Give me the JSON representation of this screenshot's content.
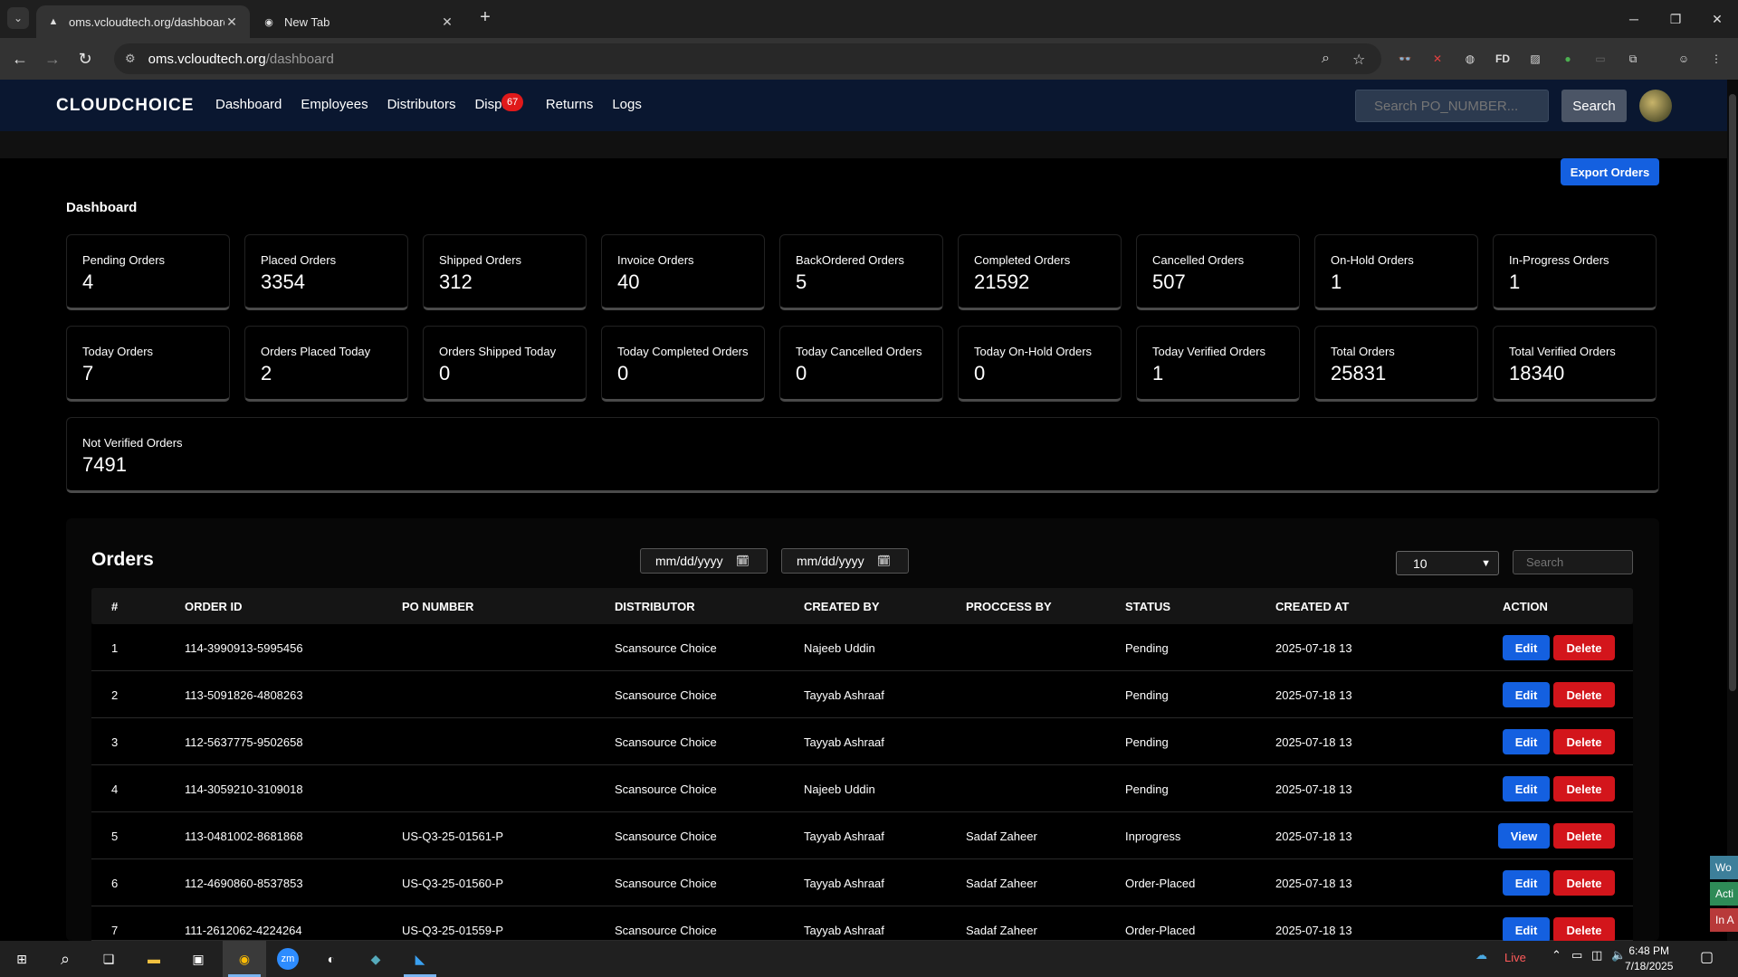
{
  "browser": {
    "tabs": [
      {
        "title": "oms.vcloudtech.org/dashboard",
        "favicon": "triangle-icon"
      },
      {
        "title": "New Tab",
        "favicon": "chrome-icon"
      }
    ],
    "url_host": "oms.vcloudtech.org",
    "url_path": "/dashboard"
  },
  "app": {
    "logo": "CLOUDCHOICE",
    "nav": [
      "Dashboard",
      "Employees",
      "Distributors",
      "Dispu",
      "Returns",
      "Logs"
    ],
    "disputes_badge": "67",
    "search_placeholder": "Search PO_NUMBER...",
    "search_button": "Search",
    "export_button": "Export Orders",
    "section_title": "Dashboard"
  },
  "stats": [
    {
      "label": "Pending Orders",
      "value": "4"
    },
    {
      "label": "Placed Orders",
      "value": "3354"
    },
    {
      "label": "Shipped Orders",
      "value": "312"
    },
    {
      "label": "Invoice Orders",
      "value": "40"
    },
    {
      "label": "BackOrdered Orders",
      "value": "5"
    },
    {
      "label": "Completed Orders",
      "value": "21592"
    },
    {
      "label": "Cancelled Orders",
      "value": "507"
    },
    {
      "label": "On-Hold Orders",
      "value": "1"
    },
    {
      "label": "In-Progress Orders",
      "value": "1"
    },
    {
      "label": "Today Orders",
      "value": "7"
    },
    {
      "label": "Orders Placed Today",
      "value": "2"
    },
    {
      "label": "Orders Shipped Today",
      "value": "0"
    },
    {
      "label": "Today Completed Orders",
      "value": "0"
    },
    {
      "label": "Today Cancelled Orders",
      "value": "0"
    },
    {
      "label": "Today On-Hold Orders",
      "value": "0"
    },
    {
      "label": "Today Verified Orders",
      "value": "1"
    },
    {
      "label": "Total Orders",
      "value": "25831"
    },
    {
      "label": "Total Verified Orders",
      "value": "18340"
    },
    {
      "label": "Not Verified Orders",
      "value": "7491"
    }
  ],
  "orders": {
    "title": "Orders",
    "date_from_placeholder": "mm/dd/yyyy",
    "date_to_placeholder": "mm/dd/yyyy",
    "page_size": "10",
    "search_placeholder": "Search",
    "columns": [
      "#",
      "ORDER ID",
      "PO NUMBER",
      "DISTRIBUTOR",
      "CREATED BY",
      "PROCCESS BY",
      "STATUS",
      "CREATED AT",
      "ACTION"
    ],
    "edit_label": "Edit",
    "view_label": "View",
    "delete_label": "Delete",
    "rows": [
      {
        "n": "1",
        "order_id": "114-3990913-5995456",
        "po": "",
        "distributor": "Scansource Choice",
        "created_by": "Najeeb Uddin",
        "process_by": "",
        "status": "Pending",
        "created_at": "2025-07-18 13",
        "action": "Edit"
      },
      {
        "n": "2",
        "order_id": "113-5091826-4808263",
        "po": "",
        "distributor": "Scansource Choice",
        "created_by": "Tayyab Ashraaf",
        "process_by": "",
        "status": "Pending",
        "created_at": "2025-07-18 13",
        "action": "Edit"
      },
      {
        "n": "3",
        "order_id": "112-5637775-9502658",
        "po": "",
        "distributor": "Scansource Choice",
        "created_by": "Tayyab Ashraaf",
        "process_by": "",
        "status": "Pending",
        "created_at": "2025-07-18 13",
        "action": "Edit"
      },
      {
        "n": "4",
        "order_id": "114-3059210-3109018",
        "po": "",
        "distributor": "Scansource Choice",
        "created_by": "Najeeb Uddin",
        "process_by": "",
        "status": "Pending",
        "created_at": "2025-07-18 13",
        "action": "Edit"
      },
      {
        "n": "5",
        "order_id": "113-0481002-8681868",
        "po": "US-Q3-25-01561-P",
        "distributor": "Scansource Choice",
        "created_by": "Tayyab Ashraaf",
        "process_by": "Sadaf Zaheer",
        "status": "Inprogress",
        "created_at": "2025-07-18 13",
        "action": "View"
      },
      {
        "n": "6",
        "order_id": "112-4690860-8537853",
        "po": "US-Q3-25-01560-P",
        "distributor": "Scansource Choice",
        "created_by": "Tayyab Ashraaf",
        "process_by": "Sadaf Zaheer",
        "status": "Order-Placed",
        "created_at": "2025-07-18 13",
        "action": "Edit"
      },
      {
        "n": "7",
        "order_id": "111-2612062-4224264",
        "po": "US-Q3-25-01559-P",
        "distributor": "Scansource Choice",
        "created_by": "Tayyab Ashraaf",
        "process_by": "Sadaf Zaheer",
        "status": "Order-Placed",
        "created_at": "2025-07-18 13",
        "action": "Edit"
      }
    ]
  },
  "side_tabs": [
    {
      "label": "Wo",
      "color": "#3d7f9a"
    },
    {
      "label": "Acti",
      "color": "#2e8b57"
    },
    {
      "label": "In A",
      "color": "#b83a3a"
    }
  ],
  "taskbar": {
    "live_label": "Live",
    "time": "6:48 PM",
    "date": "7/18/2025"
  },
  "colors": {
    "primary": "#1460e0",
    "danger": "#d3151b",
    "navbar": "#0a1730"
  }
}
